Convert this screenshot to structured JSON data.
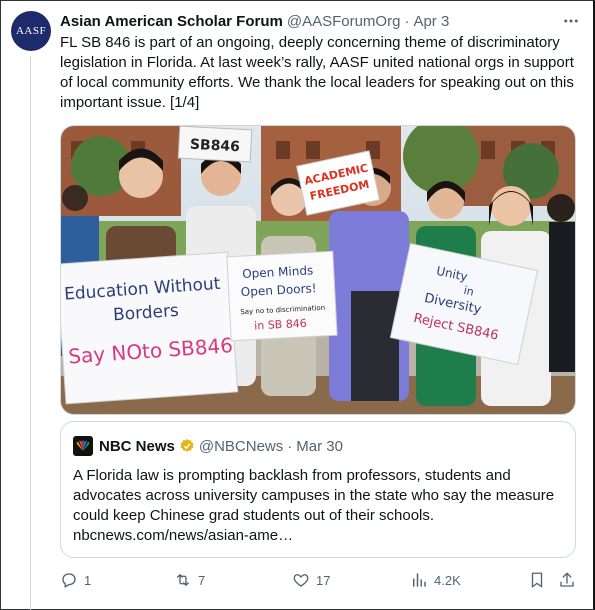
{
  "tweet": {
    "avatar_text": "AASF",
    "display_name": "Asian American Scholar Forum",
    "handle": "@AASForumOrg",
    "separator": "·",
    "date": "Apr 3",
    "more_icon": "more-icon",
    "text": "FL SB 846 is part of an ongoing, deeply concerning theme of discriminatory legislation in Florida. At last week’s rally, AASF united national orgs in support of local community efforts. We thank the local leaders for speaking out on this important issue. [1/4]"
  },
  "photo": {
    "signs": {
      "top_sign": "SB846",
      "academic_line1": "ACADEMIC",
      "academic_line2": "FREEDOM",
      "left_line1": "Education Without",
      "left_line2": "Borders",
      "left_line3": "Say NOto SB846",
      "middle_line1": "Open Minds",
      "middle_line2": "Open Doors!",
      "middle_line3": "Say no to discrimination",
      "middle_line4": "in SB 846",
      "right_line1": "Unity",
      "right_line2": "in",
      "right_line3": "Diversity",
      "right_line4": "Reject SB846"
    }
  },
  "quote": {
    "name": "NBC News",
    "handle": "@NBCNews",
    "separator": "·",
    "date": "Mar 30",
    "text": "A Florida law is prompting backlash from professors, students and advocates across university campuses in the state who say the measure could keep Chinese grad students out of their schools.",
    "link": "nbcnews.com/news/asian-ame…"
  },
  "actions": {
    "reply_count": "1",
    "retweet_count": "7",
    "like_count": "17",
    "views_count": "4.2K"
  },
  "colors": {
    "text": "#0f1419",
    "muted": "#536471",
    "border": "#cfd9de",
    "avatar_bg": "#1d2a6b",
    "verified_gold": "#e2b719"
  }
}
